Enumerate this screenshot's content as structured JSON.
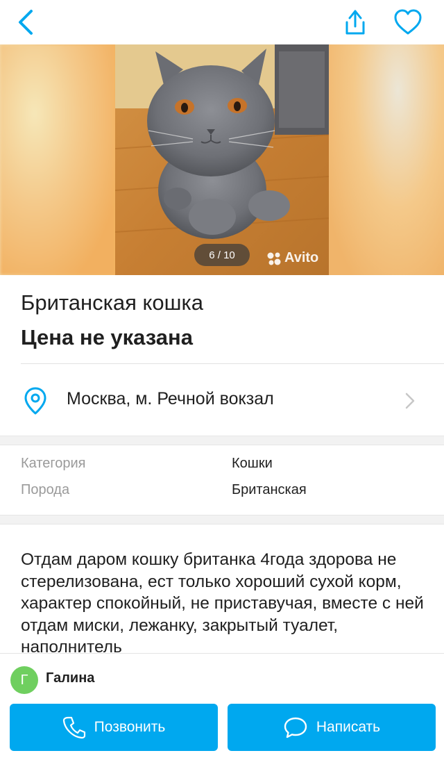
{
  "header": {
    "back_icon": "chevron-left-icon",
    "share_icon": "share-icon",
    "favorite_icon": "heart-icon",
    "accent_color": "#00a8ef"
  },
  "gallery": {
    "counter": "6 / 10",
    "watermark": "Avito"
  },
  "listing": {
    "title": "Британская кошка",
    "price": "Цена не указана"
  },
  "location": {
    "icon": "map-pin-icon",
    "text": "Москва, м. Речной вокзал"
  },
  "params": [
    {
      "key": "Категория",
      "value": "Кошки"
    },
    {
      "key": "Порода",
      "value": "Британская"
    }
  ],
  "description": "Отдам даром кошку британка 4года здорова не стерелизована, ест только хороший сухой корм, характер спокойный, не приставучая, вместе с ней отдам миски, лежанку, закрытый туалет, наполнитель",
  "seller": {
    "initial": "Г",
    "name": "Галина",
    "avatar_color": "#6fcf5f"
  },
  "actions": {
    "call_label": "Позвонить",
    "write_label": "Написать"
  }
}
